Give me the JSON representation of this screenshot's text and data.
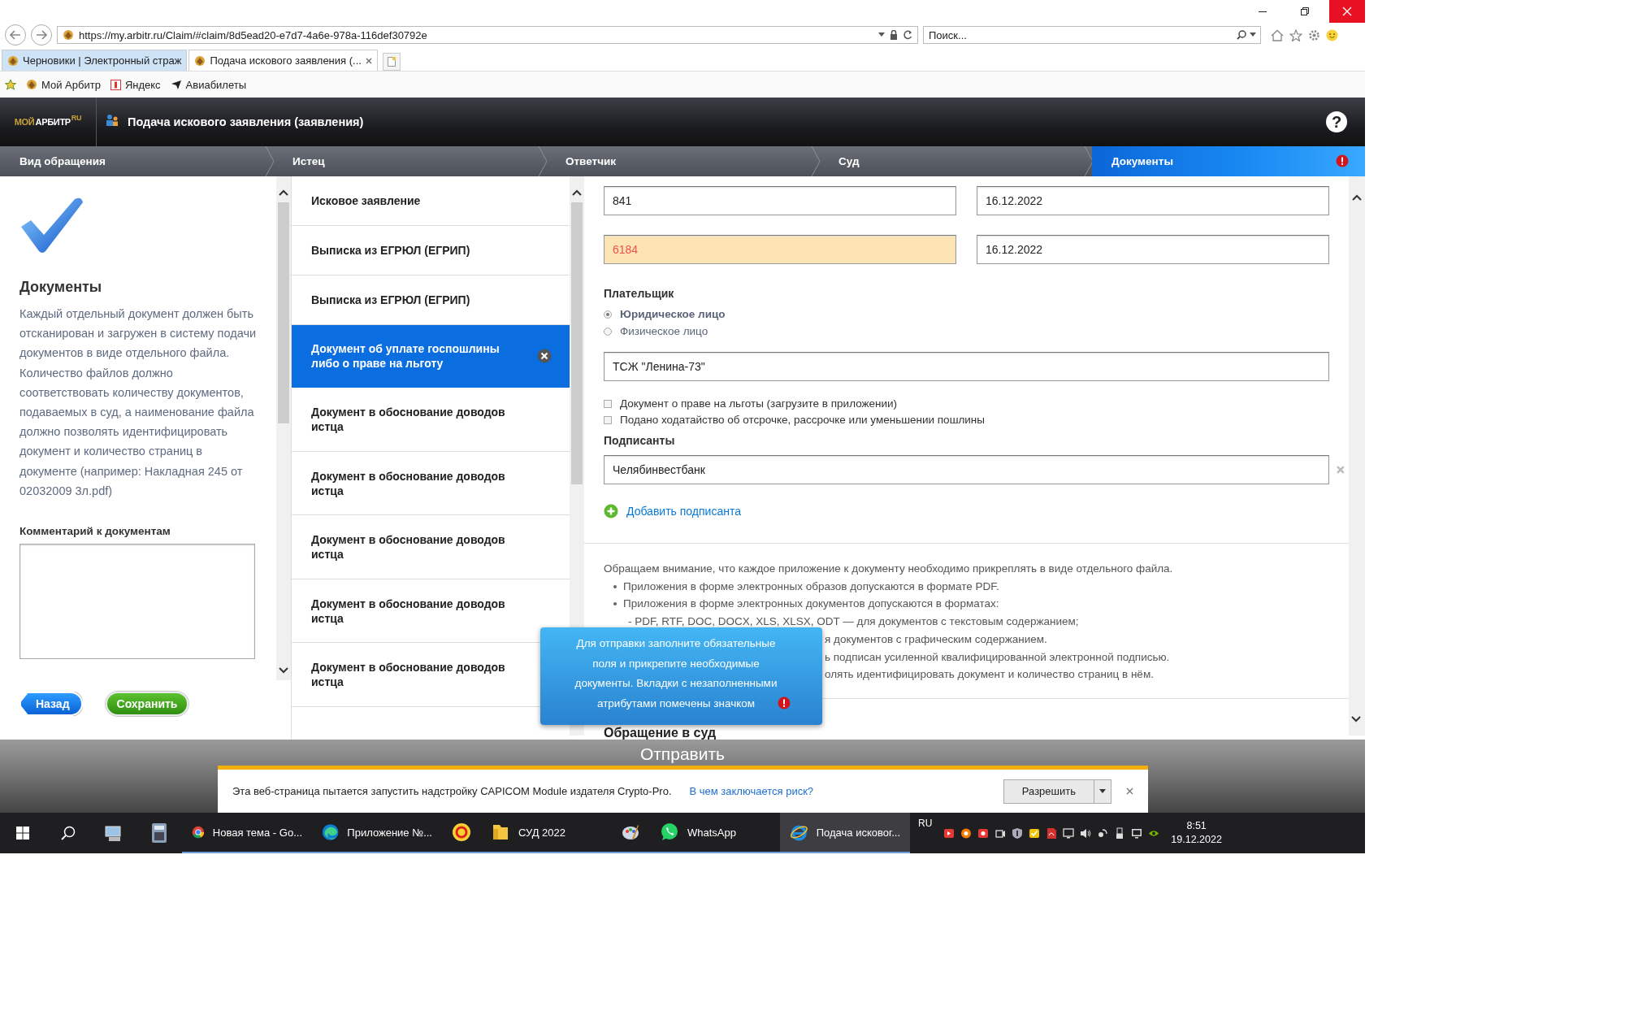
{
  "browser": {
    "url": "https://my.arbitr.ru/Claim/#claim/8d5ead20-e7d7-4a6e-978a-116def30792e",
    "search_placeholder": "Поиск...",
    "tabs": [
      {
        "label": "Черновики | Электронный страж",
        "selected": false
      },
      {
        "label": "Подача искового заявления (...",
        "selected": true
      }
    ],
    "favorites": [
      "Мой Арбитр",
      "Яндекс",
      "Авиабилеты"
    ]
  },
  "app": {
    "logo": {
      "first": "МОЙ",
      "second": "АРБИТР",
      "suffix": "RU"
    },
    "title": "Подача искового заявления (заявления)",
    "help": "?"
  },
  "steps": [
    {
      "label": "Вид обращения",
      "selected": false,
      "warning": false
    },
    {
      "label": "Истец",
      "selected": false,
      "warning": false
    },
    {
      "label": "Ответчик",
      "selected": false,
      "warning": false
    },
    {
      "label": "Суд",
      "selected": false,
      "warning": false
    },
    {
      "label": "Документы",
      "selected": true,
      "warning": true
    }
  ],
  "sidebar": {
    "title": "Документы",
    "description": "Каждый отдельный документ должен быть отсканирован и загружен в систему подачи документов в виде отдельного файла. Количество файлов должно соответствовать количеству документов, подаваемых в суд, а наименование файла должно позволять идентифицировать документ и количество страниц в документе (например: Накладная 245 от 02032009 3л.pdf)",
    "comment_label": "Комментарий к документам",
    "back": "Назад",
    "save": "Сохранить"
  },
  "documents": [
    {
      "label": "Исковое заявление",
      "selected": false
    },
    {
      "label": "Выписка из ЕГРЮЛ (ЕГРИП)",
      "selected": false
    },
    {
      "label": "Выписка из ЕГРЮЛ (ЕГРИП)",
      "selected": false
    },
    {
      "label": "Документ об уплате госпошлины либо о праве на льготу",
      "selected": true
    },
    {
      "label": "Документ в обоснование доводов истца",
      "selected": false
    },
    {
      "label": "Документ в обоснование доводов истца",
      "selected": false
    },
    {
      "label": "Документ в обоснование доводов истца",
      "selected": false
    },
    {
      "label": "Документ в обоснование доводов истца",
      "selected": false
    },
    {
      "label": "Документ в обоснование доводов истца",
      "selected": false
    }
  ],
  "form": {
    "fields": [
      {
        "value": "841",
        "invalid": false
      },
      {
        "value": "16.12.2022",
        "invalid": false
      },
      {
        "value": "6184",
        "invalid": true
      },
      {
        "value": "16.12.2022",
        "invalid": false
      }
    ],
    "payer_label": "Плательщик",
    "payer_options": [
      {
        "label": "Юридическое лицо",
        "selected": true
      },
      {
        "label": "Физическое лицо",
        "selected": false
      }
    ],
    "payer_name": "ТСЖ \"Ленина-73\"",
    "checkboxes": [
      {
        "label": "Документ о праве на льготы (загрузите в приложении)",
        "checked": false
      },
      {
        "label": "Подано ходатайство об отсрочке, рассрочке или уменьшении пошлины",
        "checked": false
      }
    ],
    "signers_label": "Подписанты",
    "signers": [
      "Челябинвестбанк"
    ],
    "add_signer": "Добавить подписанта"
  },
  "notice": {
    "intro": "Обращаем внимание, что каждое приложение к документу необходимо прикреплять в виде отдельного файла.",
    "lines": [
      {
        "kind": "bullet",
        "text": "Приложения в форме электронных образов допускаются в формате PDF."
      },
      {
        "kind": "bullet",
        "text": "Приложения в форме электронных документов допускаются в форматах:"
      },
      {
        "kind": "sub",
        "text": "- PDF, RTF, DOC, DOCX, XLS, XLSX, ODT — для документов с текстовым содержанием;"
      },
      {
        "kind": "covered",
        "text": "я документов с графическим содержанием."
      },
      {
        "kind": "covered",
        "text": "ь подписан усиленной квалифицированной электронной подписью."
      },
      {
        "kind": "covered",
        "text": "олять идентифицировать документ и количество страниц в нём."
      }
    ]
  },
  "section_heading": "Обращение в суд",
  "tooltip": "Для отправки заполните обязательные поля и прикрепите необходимые документы. Вкладки с незаполненными атрибутами помечены значком",
  "submit": "Отправить",
  "infobar": {
    "message": "Эта веб-страница пытается запустить надстройку CAPICOM Module издателя Crypto-Pro.",
    "link": "В чем заключается риск?",
    "button": "Разрешить"
  },
  "taskbar": {
    "apps": [
      {
        "kind": "chrome",
        "label": "Новая тема - Go...",
        "selected": false
      },
      {
        "kind": "edge",
        "label": "Приложение №...",
        "selected": false
      },
      {
        "kind": "onec",
        "selected": false
      },
      {
        "kind": "folder",
        "label": "СУД 2022",
        "selected": false
      },
      {
        "kind": "paint",
        "selected": false
      },
      {
        "kind": "whatsapp",
        "label": "WhatsApp",
        "selected": false
      },
      {
        "kind": "ie",
        "label": "Подача исковог...",
        "selected": true
      }
    ],
    "lang": "RU",
    "time": "8:51",
    "date": "19.12.2022"
  }
}
